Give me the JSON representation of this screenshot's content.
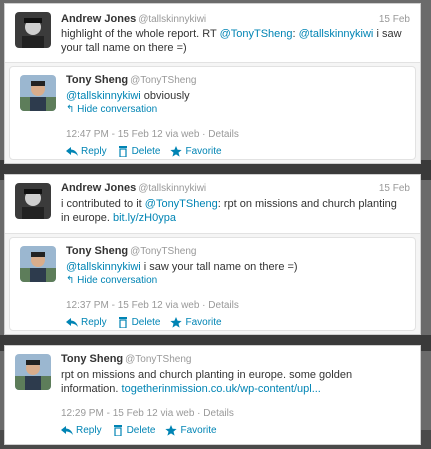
{
  "colors": {
    "link": "#0084b4",
    "muted": "#999999",
    "text": "#333333",
    "background": "#5a5a5a"
  },
  "actions": {
    "reply": "Reply",
    "delete": "Delete",
    "favorite": "Favorite"
  },
  "icons": {
    "reply": "reply-arrow-icon",
    "delete": "trash-icon",
    "favorite": "star-icon",
    "toggle": "reply-arrow-icon"
  },
  "panels": [
    {
      "tweet": {
        "name": "Andrew Jones",
        "handle": "@tallskinnykiwi",
        "date": "15 Feb",
        "text_pre": "highlight of the whole report. RT ",
        "mention1": "@TonyTSheng",
        "text_mid": ": ",
        "mention2": "@tallskinnykiwi",
        "text_post": " i saw your tall name on there =)"
      },
      "reply": {
        "name": "Tony Sheng",
        "handle": "@TonyTSheng",
        "mention": "@tallskinnykiwi",
        "text": " obviously",
        "toggle": "Hide conversation",
        "meta": "12:47 PM - 15 Feb 12 via web · Details"
      }
    },
    {
      "tweet": {
        "name": "Andrew Jones",
        "handle": "@tallskinnykiwi",
        "date": "15 Feb",
        "text_pre": "i contributed to it ",
        "mention1": "@TonyTSheng",
        "text_post": ": rpt on missions and church planting in europe. ",
        "link": "bit.ly/zH0ypa"
      },
      "reply": {
        "name": "Tony Sheng",
        "handle": "@TonyTSheng",
        "mention": "@tallskinnykiwi",
        "text": " i saw your tall name on there =)",
        "toggle": "Hide conversation",
        "meta": "12:37 PM - 15 Feb 12 via web · Details"
      }
    },
    {
      "tweet": {
        "name": "Tony Sheng",
        "handle": "@TonyTSheng",
        "text": "rpt on missions and church planting in europe. some golden information. ",
        "link": "togetherinmission.co.uk/wp-content/upl...",
        "meta": "12:29 PM - 15 Feb 12 via web · Details"
      }
    }
  ]
}
